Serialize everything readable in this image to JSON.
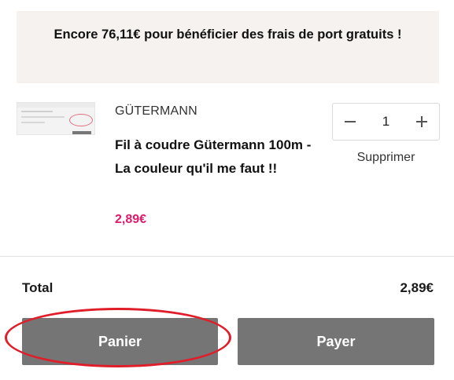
{
  "banner": {
    "free_shipping_text": "Encore 76,11€ pour bénéficier des frais de port gratuits !"
  },
  "cart_item": {
    "brand": "GÜTERMANN",
    "name": "Fil à coudre Gütermann 100m - La couleur qu'il me faut !!",
    "price": "2,89€",
    "quantity": "1",
    "remove_label": "Supprimer"
  },
  "summary": {
    "total_label": "Total",
    "total_value": "2,89€"
  },
  "actions": {
    "cart_label": "Panier",
    "pay_label": "Payer"
  },
  "colors": {
    "price": "#e0196b",
    "button": "#757575",
    "banner_bg": "#f5f2ef",
    "annotation": "#e01e2a"
  },
  "icons": [
    "minus-icon",
    "plus-icon"
  ]
}
